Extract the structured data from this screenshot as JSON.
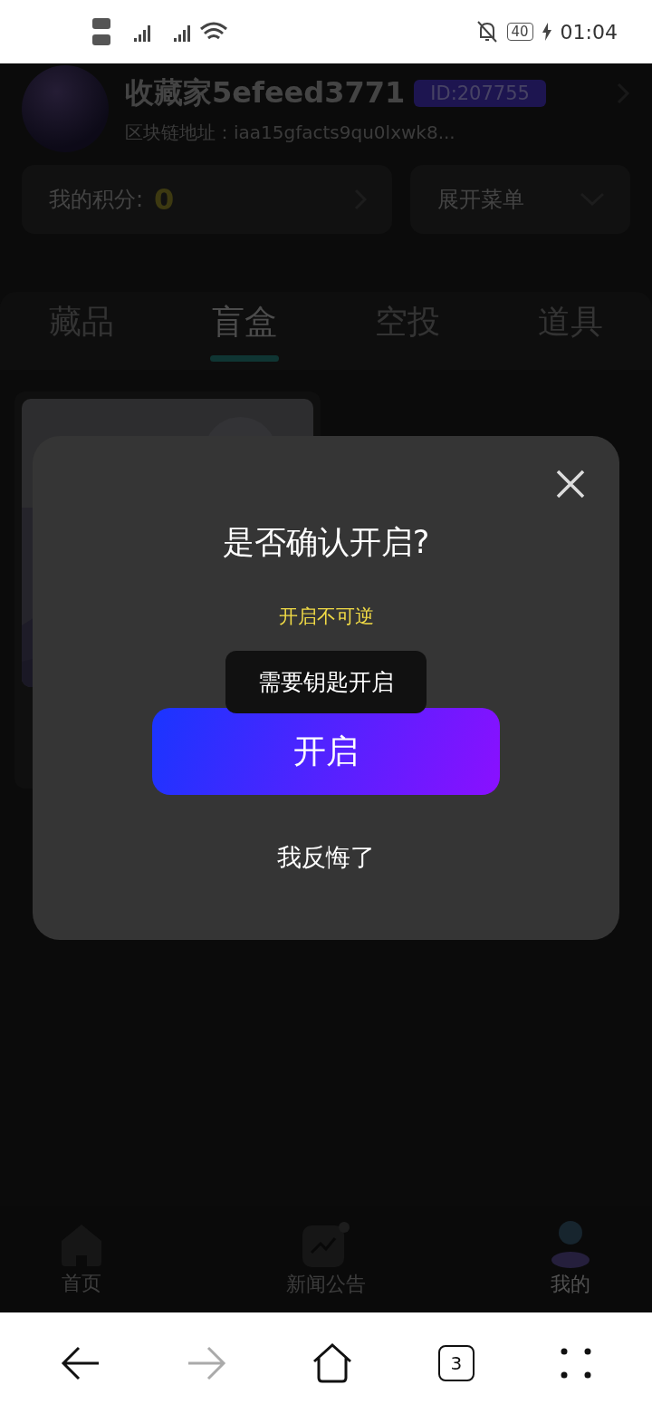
{
  "status_bar": {
    "battery": "40",
    "time": "01:04"
  },
  "profile": {
    "nickname": "收藏家5efeed3771",
    "id_badge": "ID:207755",
    "address": "区块链地址：iaa15gfacts9qu0lxwk8..."
  },
  "points": {
    "label": "我的积分:",
    "value": "0"
  },
  "menu_toggle": {
    "label": "展开菜单"
  },
  "tabs": [
    {
      "label": "藏品",
      "selected": false
    },
    {
      "label": "盲盒",
      "selected": true
    },
    {
      "label": "空投",
      "selected": false
    },
    {
      "label": "道具",
      "selected": false
    }
  ],
  "dialog": {
    "title": "是否确认开启?",
    "warning": "开启不可逆",
    "tooltip": "需要钥匙开启",
    "confirm": "开启",
    "cancel": "我反悔了"
  },
  "bottom_nav": [
    {
      "label": "首页",
      "kind": "home",
      "selected": false
    },
    {
      "label": "新闻公告",
      "kind": "news",
      "selected": false
    },
    {
      "label": "我的",
      "kind": "profile",
      "selected": true
    }
  ],
  "browser_bar": {
    "tab_count": "3"
  }
}
